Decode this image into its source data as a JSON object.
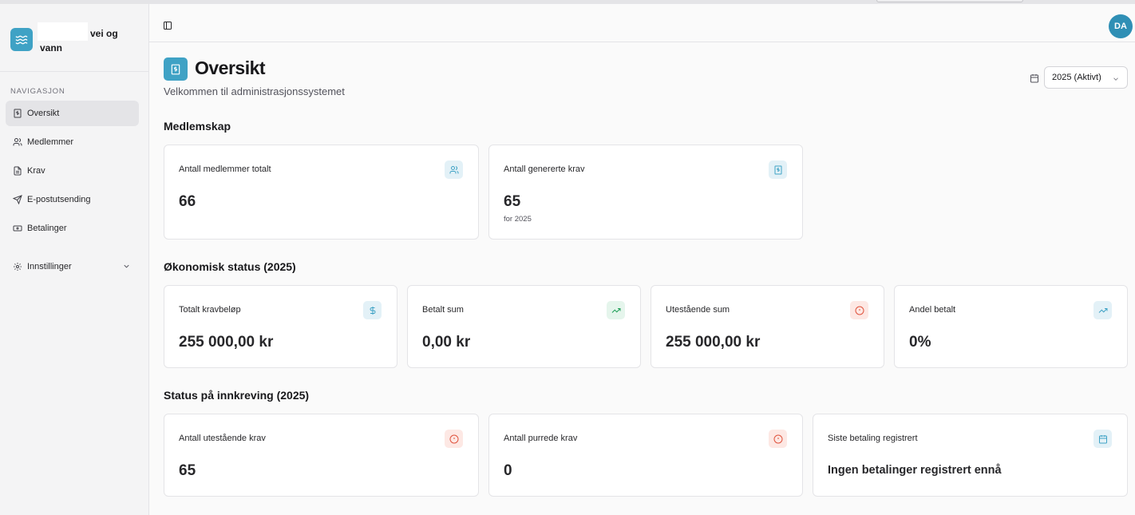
{
  "brand": {
    "name_line1": "vei og",
    "name_line2": "vann"
  },
  "nav": {
    "heading": "NAVIGASJON",
    "items": [
      {
        "label": "Oversikt",
        "icon": "receipt-icon",
        "active": true
      },
      {
        "label": "Medlemmer",
        "icon": "users-icon"
      },
      {
        "label": "Krav",
        "icon": "file-text-icon"
      },
      {
        "label": "E-postutsending",
        "icon": "send-icon"
      },
      {
        "label": "Betalinger",
        "icon": "banknote-icon"
      },
      {
        "label": "Innstillinger",
        "icon": "settings-icon"
      }
    ]
  },
  "user": {
    "initials": "DA"
  },
  "page": {
    "title": "Oversikt",
    "subtitle": "Velkommen til administrasjonssystemet",
    "year_select": "2025 (Aktivt)"
  },
  "sections": {
    "membership": "Medlemskap",
    "economy": "Økonomisk status (2025)",
    "collection": "Status på innkreving (2025)"
  },
  "cards": {
    "members_total": {
      "label": "Antall medlemmer totalt",
      "value": "66",
      "icon": "users-icon"
    },
    "generated_claims": {
      "label": "Antall genererte krav",
      "value": "65",
      "sub": "for 2025",
      "icon": "receipt-icon"
    },
    "total_amount": {
      "label": "Totalt kravbeløp",
      "value": "255 000,00 kr",
      "icon": "dollar-icon"
    },
    "paid_sum": {
      "label": "Betalt sum",
      "value": "0,00 kr",
      "icon": "trending-up-icon"
    },
    "outstanding_sum": {
      "label": "Utestående sum",
      "value": "255 000,00 kr",
      "icon": "alert-circle-icon"
    },
    "share_paid": {
      "label": "Andel betalt",
      "value": "0%",
      "icon": "trending-up-icon"
    },
    "outstanding_claims": {
      "label": "Antall utestående krav",
      "value": "65",
      "icon": "alert-circle-icon"
    },
    "reminded_claims": {
      "label": "Antall purrede krav",
      "value": "0",
      "icon": "alert-circle-icon"
    },
    "last_payment": {
      "label": "Siste betaling registrert",
      "value": "Ingen betalinger registrert ennå",
      "icon": "calendar-icon"
    }
  },
  "colors": {
    "accent": "#3fa2c5",
    "avatar": "#2f8fb5",
    "green": "#22a05a",
    "red": "#e0533d"
  }
}
